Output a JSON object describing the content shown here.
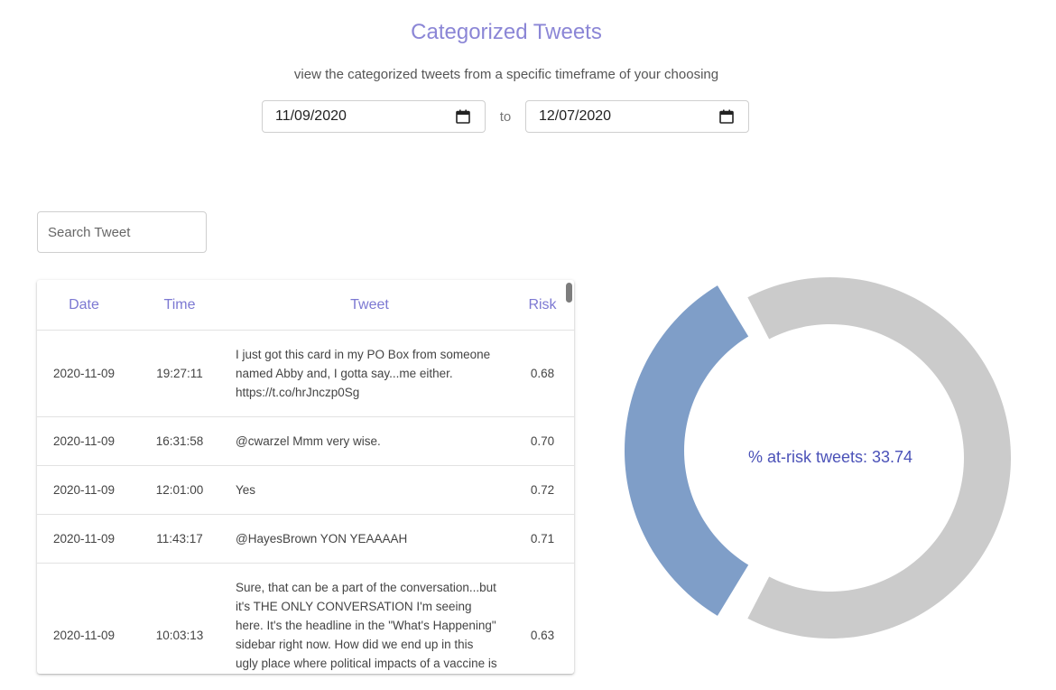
{
  "header": {
    "title": "Categorized Tweets",
    "subtitle": "view the categorized tweets from a specific timeframe of your choosing"
  },
  "date_range": {
    "start": "11/09/2020",
    "separator": "to",
    "end": "12/07/2020"
  },
  "search": {
    "placeholder": "Search Tweet",
    "value": ""
  },
  "table": {
    "columns": [
      "Date",
      "Time",
      "Tweet",
      "Risk"
    ],
    "rows": [
      {
        "date": "2020-11-09",
        "time": "19:27:11",
        "tweet": "I just got this card in my PO Box from someone named Abby and, I gotta say...me either.  https://t.co/hrJnczp0Sg",
        "risk": "0.68"
      },
      {
        "date": "2020-11-09",
        "time": "16:31:58",
        "tweet": "@cwarzel Mmm very wise.",
        "risk": "0.70"
      },
      {
        "date": "2020-11-09",
        "time": "12:01:00",
        "tweet": "Yes",
        "risk": "0.72"
      },
      {
        "date": "2020-11-09",
        "time": "11:43:17",
        "tweet": "@HayesBrown YON YEAAAAH",
        "risk": "0.71"
      },
      {
        "date": "2020-11-09",
        "time": "10:03:13",
        "tweet": "Sure, that can be a part of the conversation...but it's THE ONLY CONVERSATION I'm seeing here. It's the headline in the \"What's Happening\" sidebar right now. How did we end up in this ugly place where political impacts of a vaccine is a",
        "risk": "0.63"
      }
    ]
  },
  "chart_data": {
    "type": "pie",
    "label": "% at-risk tweets: 33.74",
    "values": [
      33.74,
      66.26
    ],
    "colors": [
      "#7f9ec8",
      "#cbcbcb"
    ],
    "label_color": "#4b52b8"
  },
  "colors": {
    "accent": "#8b86d6",
    "header_text": "#7c78d2"
  }
}
